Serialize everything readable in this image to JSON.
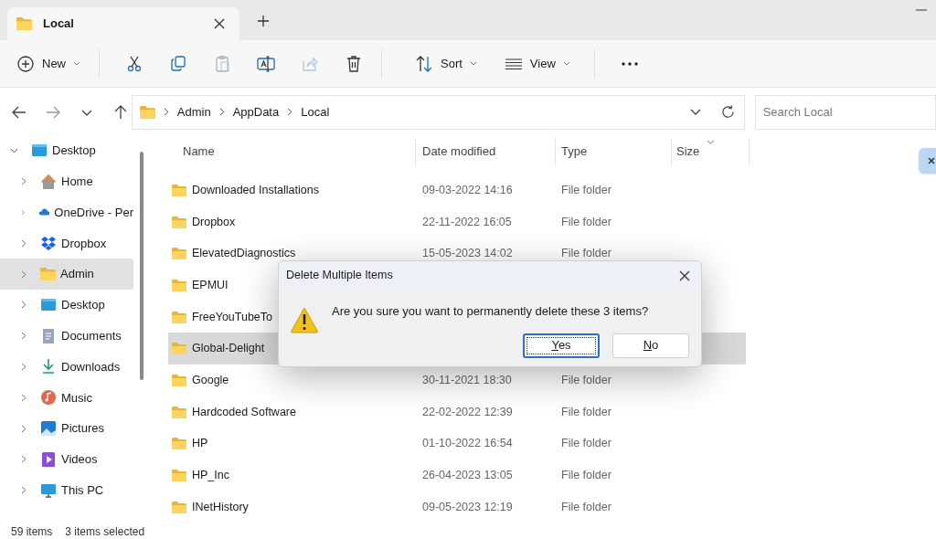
{
  "tab": {
    "title": "Local"
  },
  "toolbar": [
    {
      "kind": "new",
      "label": "New",
      "disabled": false
    },
    {
      "kind": "cut",
      "disabled": false
    },
    {
      "kind": "copy",
      "disabled": false
    },
    {
      "kind": "paste",
      "disabled": true
    },
    {
      "kind": "rename",
      "disabled": false
    },
    {
      "kind": "share",
      "disabled": true
    },
    {
      "kind": "delete",
      "disabled": false
    },
    {
      "kind": "sort",
      "label": "Sort",
      "disabled": false
    },
    {
      "kind": "view",
      "label": "View",
      "disabled": false
    },
    {
      "kind": "more",
      "disabled": false
    }
  ],
  "address": {
    "breadcrumbs": [
      "Admin",
      "AppData",
      "Local"
    ],
    "search_placeholder": "Search Local"
  },
  "sidebar": {
    "items": [
      {
        "label": "Desktop",
        "kind": "desktop",
        "expanded": true,
        "selected": false,
        "children": [
          {
            "label": "Home",
            "kind": "home",
            "expanded": false,
            "selected": false
          },
          {
            "label": "OneDrive - Per",
            "kind": "onedrive",
            "expanded": false,
            "selected": false
          },
          {
            "label": "Dropbox",
            "kind": "dropbox",
            "expanded": false,
            "selected": false
          },
          {
            "label": "Admin",
            "kind": "folder",
            "expanded": false,
            "selected": true
          },
          {
            "label": "Desktop",
            "kind": "desktop",
            "expanded": false,
            "selected": false
          },
          {
            "label": "Documents",
            "kind": "documents",
            "expanded": false,
            "selected": false
          },
          {
            "label": "Downloads",
            "kind": "downloads",
            "expanded": false,
            "selected": false
          },
          {
            "label": "Music",
            "kind": "music",
            "expanded": false,
            "selected": false
          },
          {
            "label": "Pictures",
            "kind": "pictures",
            "expanded": false,
            "selected": false
          },
          {
            "label": "Videos",
            "kind": "videos",
            "expanded": false,
            "selected": false
          },
          {
            "label": "This PC",
            "kind": "pc",
            "expanded": false,
            "selected": false
          }
        ]
      }
    ]
  },
  "files": {
    "columns": [
      "Name",
      "Date modified",
      "Type",
      "Size"
    ],
    "rows": [
      {
        "name": "Downloaded Installations",
        "date": "09-03-2022 14:16",
        "type": "File folder",
        "selected": false
      },
      {
        "name": "Dropbox",
        "date": "22-11-2022 16:05",
        "type": "File folder",
        "selected": false
      },
      {
        "name": "ElevatedDiagnostics",
        "date": "15-05-2023 14:02",
        "type": "File folder",
        "selected": false
      },
      {
        "name": "EPMUI",
        "selected": false
      },
      {
        "name": "FreeYouTubeTo",
        "selected": false
      },
      {
        "name": "Global-Delight",
        "selected": true
      },
      {
        "name": "Google",
        "date": "30-11-2021 18:30",
        "type": "File folder",
        "selected": false
      },
      {
        "name": "Hardcoded Software",
        "date": "22-02-2022 12:39",
        "type": "File folder",
        "selected": false
      },
      {
        "name": "HP",
        "date": "01-10-2022 16:54",
        "type": "File folder",
        "selected": false
      },
      {
        "name": "HP_Inc",
        "date": "26-04-2023 13:05",
        "type": "File folder",
        "selected": false
      },
      {
        "name": "INetHistory",
        "date": "09-05-2023 12:19",
        "type": "File folder",
        "selected": false
      }
    ]
  },
  "dialog": {
    "title": "Delete Multiple Items",
    "message": "Are you sure you want to permanently delete these 3 items?",
    "buttons": [
      {
        "label": "Yes",
        "focused": true
      },
      {
        "label": "No",
        "focused": false
      }
    ]
  },
  "status_bar": {
    "count": "59 items",
    "selection": "3 items selected"
  }
}
